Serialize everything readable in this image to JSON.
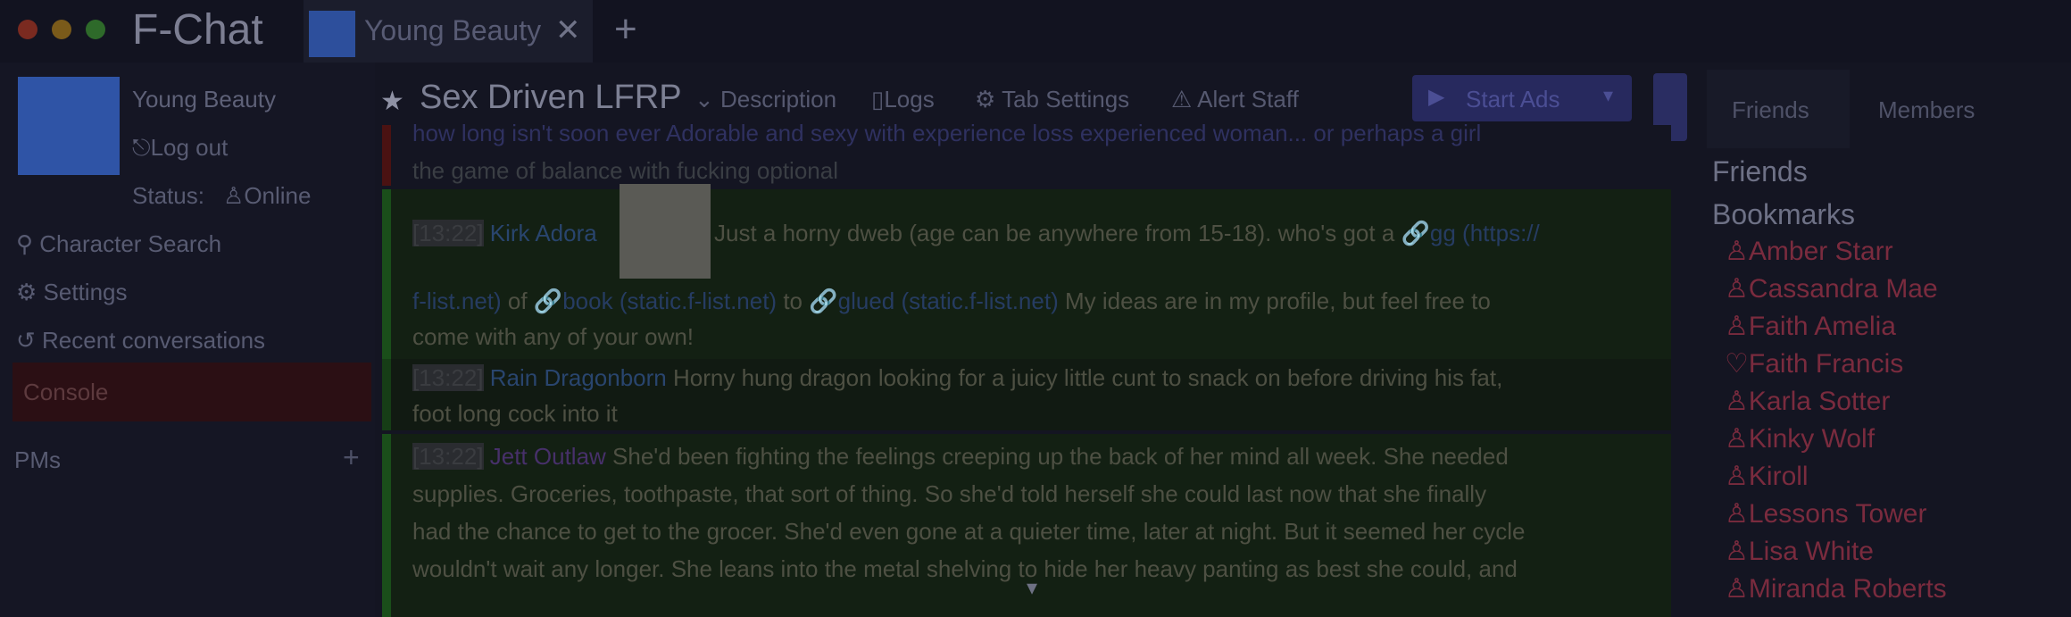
{
  "window": {
    "app_title": "F-Chat",
    "tab_label": "Young Beauty",
    "tab_close_icon": "close-icon",
    "new_tab_icon": "plus-icon"
  },
  "sidebar": {
    "character_name": "Young Beauty",
    "logout_label": "Log out",
    "status_label": "Status:",
    "status_value": "Online",
    "menu": [
      {
        "label": "Character Search",
        "icon": "search-icon"
      },
      {
        "label": "Settings",
        "icon": "gear-icon"
      },
      {
        "label": "Recent conversations",
        "icon": "history-icon"
      }
    ],
    "console_label": "Console",
    "pms_label": "PMs"
  },
  "channel": {
    "title": "Sex Driven LFRP",
    "description_label": "Description",
    "logs_label": "Logs",
    "tab_settings_label": "Tab Settings",
    "alert_staff_label": "Alert Staff",
    "start_ads_label": "Start Ads"
  },
  "right_panel": {
    "tabs": [
      "Friends",
      "Members"
    ],
    "friends_heading": "Friends",
    "bookmarks_heading": "Bookmarks",
    "bookmarks": [
      "Amber Starr",
      "Cassandra Mae",
      "Faith Amelia",
      "Faith Francis",
      "Karla Sotter",
      "Kinky Wolf",
      "Kiroll",
      "Lessons Tower",
      "Lisa White",
      "Miranda Roberts"
    ]
  },
  "messages": {
    "top_line_1": "how long isn't soon ever Adorable and sexy with experience loss experienced woman... or perhaps a girl",
    "top_line_2": "the game of balance with fucking optional",
    "msg1": {
      "timestamp": "[13:22]",
      "author": "Kirk Adora",
      "text_1": "Just a horny dweb (age can be anywhere from 15-18). who's got a",
      "gg_label": "gg",
      "link_a": "(https://",
      "link_a2": "f-list.net)",
      "text_2": "of",
      "link_b_label": "book",
      "link_b": "(static.f-list.net)",
      "text_3": "to",
      "link_c_label": "glued",
      "link_c": "(static.f-list.net)",
      "text_4": "My ideas are in my profile, but feel free to",
      "text_5": "come with any of your own!"
    },
    "msg2": {
      "timestamp": "[13:22]",
      "author": "Rain Dragonborn",
      "text_1": "Horny hung dragon looking for a juicy little cunt to snack on before driving his fat,",
      "text_2": "foot long cock into it"
    },
    "msg3": {
      "timestamp": "[13:22]",
      "author": "Jett Outlaw",
      "text_1": "She'd been fighting the feelings creeping up the back of her mind all week. She needed",
      "text_2": "supplies. Groceries, toothpaste, that sort of thing. So she'd told herself she could last now that she finally",
      "text_3": "had the chance to get to the grocer. She'd even gone at a quieter time, later at night. But it seemed her cycle",
      "text_4": "wouldn't wait any longer. She leans into the metal shelving to hide her heavy panting as best she could, and"
    },
    "scroll_icon": "chevron-down-icon"
  },
  "colors": {
    "background": "#141522",
    "accent_button": "#27295e",
    "bookmark": "#7a2b3e",
    "console_highlight": "#2b0f14",
    "ad_background": "#132013"
  }
}
